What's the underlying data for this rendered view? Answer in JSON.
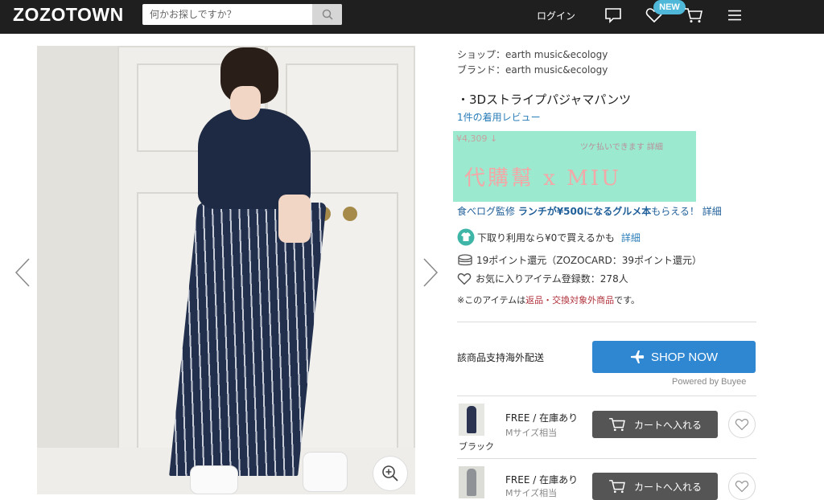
{
  "header": {
    "logo": "ZOZOTOWN",
    "search_placeholder": "何かお探しですか？",
    "login": "ログイン",
    "new_badge": "NEW"
  },
  "product": {
    "shop": "ショップ：earth music&ecology",
    "brand": "ブランド：earth music&ecology",
    "name": "・3Dストライプパジャマパンツ",
    "review": "1件の着用レビュー",
    "watermark_price": "¥4,309 ↓",
    "watermark_note": "ツケ払いできます 詳細",
    "watermark_text": "代購幫 x MIU",
    "campaign_prefix": "食べログ監修 ",
    "campaign_bold": "ランチが¥500になるグルメ本",
    "campaign_suffix": "もらえる！",
    "campaign_link": "詳細",
    "trade_text": "下取り利用なら¥0で買えるかも",
    "trade_link": "詳細",
    "points": "19ポイント還元（ZOZOCARD：39ポイント還元）",
    "favorites": "お気に入りアイテム登録数：278人",
    "notice_prefix": "※このアイテムは",
    "notice_link": "返品・交換対象外商品",
    "notice_suffix": "です。"
  },
  "overseas": {
    "label": "該商品支持海外配送",
    "button": "SHOP NOW",
    "powered": "Powered by Buyee"
  },
  "variants": [
    {
      "color": "ブラック",
      "stock": "FREE / 在庫あり",
      "size": "Mサイズ相当",
      "cart": "カートへ入れる"
    },
    {
      "color": "",
      "stock": "FREE / 在庫あり",
      "size": "Mサイズ相当",
      "cart": "カートへ入れる"
    }
  ],
  "colors": {
    "topbar": "#1f1f1f",
    "accent_blue": "#2f87d2",
    "link_blue": "#2a7db8",
    "watermark_bg": "#9be9cf",
    "cart_button": "#555555",
    "new_badge": "#4fb8d8"
  },
  "icons": [
    "search-icon",
    "chat-icon",
    "heart-icon",
    "cart-icon",
    "menu-icon",
    "chevron-left-icon",
    "chevron-right-icon",
    "zoom-in-icon",
    "shirt-icon",
    "coins-icon",
    "plane-icon"
  ]
}
